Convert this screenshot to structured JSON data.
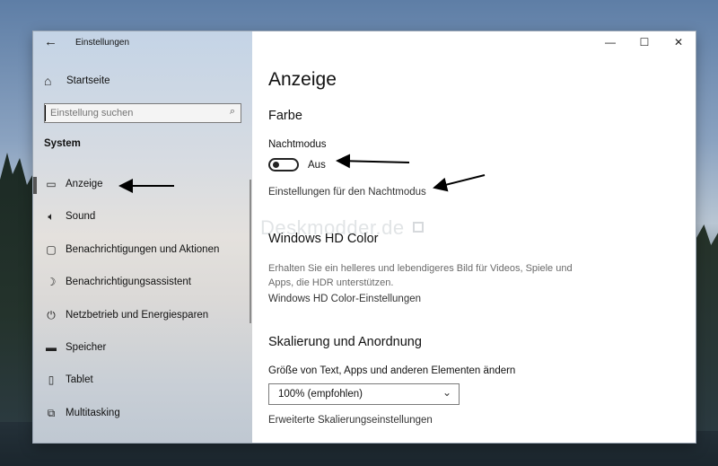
{
  "window": {
    "title": "Einstellungen",
    "controls": {
      "minimize": "—",
      "maximize": "☐",
      "close": "✕"
    }
  },
  "sidebar": {
    "home_label": "Startseite",
    "search": {
      "placeholder": "Einstellung suchen",
      "value": ""
    },
    "section_label": "System",
    "items": [
      {
        "label": "Anzeige",
        "icon": "display-icon",
        "glyph": "▭",
        "active": true
      },
      {
        "label": "Sound",
        "icon": "speaker-icon",
        "glyph": "🔈︎",
        "active": false
      },
      {
        "label": "Benachrichtigungen und Aktionen",
        "icon": "notification-icon",
        "glyph": "▢",
        "active": false
      },
      {
        "label": "Benachrichtigungsassistent",
        "icon": "moon-icon",
        "glyph": "☽",
        "active": false
      },
      {
        "label": "Netzbetrieb und Energiesparen",
        "icon": "power-icon",
        "glyph": "⏻",
        "active": false
      },
      {
        "label": "Speicher",
        "icon": "storage-icon",
        "glyph": "▬",
        "active": false
      },
      {
        "label": "Tablet",
        "icon": "tablet-icon",
        "glyph": "▯",
        "active": false
      },
      {
        "label": "Multitasking",
        "icon": "multitasking-icon",
        "glyph": "⧉",
        "active": false
      }
    ]
  },
  "main": {
    "title": "Anzeige",
    "farbe": {
      "heading": "Farbe",
      "nightmode_label": "Nachtmodus",
      "nightmode_state": "Aus",
      "nightmode_on": false,
      "nightmode_settings_link": "Einstellungen für den Nachtmodus"
    },
    "hdr": {
      "heading": "Windows HD Color",
      "description": "Erhalten Sie ein helleres und lebendigeres Bild für Videos, Spiele und Apps, die HDR unterstützen.",
      "settings_link": "Windows HD Color-Einstellungen"
    },
    "scaling": {
      "heading": "Skalierung und Anordnung",
      "size_label": "Größe von Text, Apps und anderen Elementen ändern",
      "size_value": "100% (empfohlen)",
      "advanced_link": "Erweiterte Skalierungseinstellungen"
    }
  },
  "watermark": "Deskmodder.de",
  "colors": {
    "arrow": "#000000",
    "toggle_off": "#222222",
    "link_text": "#333333"
  }
}
